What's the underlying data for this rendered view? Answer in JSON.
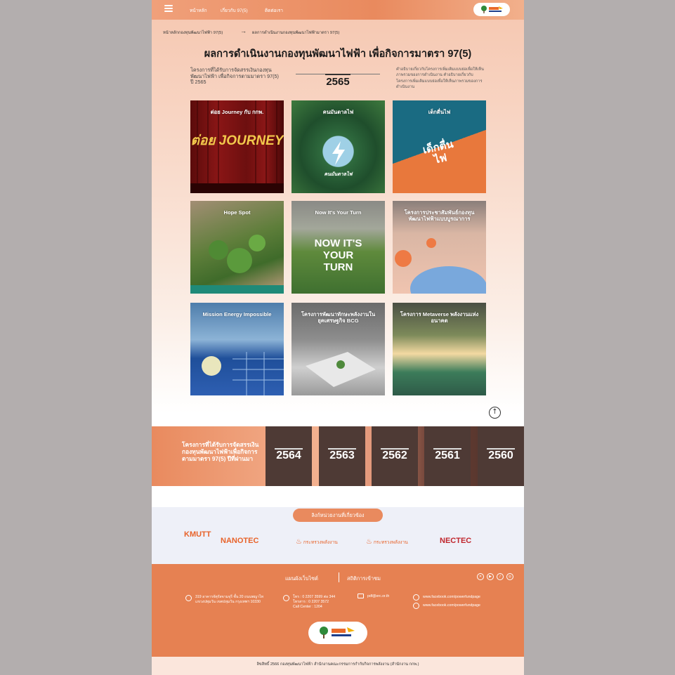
{
  "nav": {
    "links": [
      "หน้าหลัก",
      "เกี่ยวกับ 97(5)",
      "ติดต่อเรา"
    ]
  },
  "breadcrumb": {
    "home": "หน้าหลักกองทุนพัฒนาไฟฟ้า 97(5)",
    "current": "ผลการดำเนินงานกองทุนพัฒนาไฟฟ้ามาตรา 97(5)"
  },
  "title": "ผลการดำเนินงานกองทุนพัฒนาไฟฟ้า เพื่อกิจการมาตรา 97(5)",
  "intro": {
    "left": "โครงการที่ได้รับการจัดสรรเงินกองทุนพัฒนาไฟฟ้า เพื่อกิจการตามมาตรา 97(5) ปี 2565",
    "year": "2565",
    "right": "คำอธิบายเกี่ยวกับโครงการเพิ่มเติมแบบย่อเพื่อให้เห็นภาพรวมของการดำเนินงาน คำอธิบายเกี่ยวกับโครงการเพิ่มเติมแบบย่อเพื่อให้เห็นภาพรวมของการดำเนินงาน"
  },
  "projects": [
    {
      "title": "ต่อย Journey กับ กกพ.",
      "art": "ต่อย JOURNEY"
    },
    {
      "title": "คนมันตาลไฟ",
      "art": "คนมันตาลไฟ"
    },
    {
      "title": "เด็กตื่นไฟ",
      "art": "เด็กตื่นไฟ"
    },
    {
      "title": "Hope Spot",
      "art": ""
    },
    {
      "title": "Now It's Your Turn",
      "art": "NOW IT'S YOUR TURN"
    },
    {
      "title": "โครงการประชาสัมพันธ์กองทุนพัฒนาไฟฟ้าแบบบูรณาการ",
      "art": ""
    },
    {
      "title": "Mission Energy Impossible",
      "art": ""
    },
    {
      "title": "โครงการพัฒนาทักษะพลังงานในยุคเศรษฐกิจ BCG",
      "art": ""
    },
    {
      "title": "โครงการ Metaverse พลังงานแห่งอนาคต",
      "art": ""
    }
  ],
  "past": {
    "label": "โครงการที่ได้รับการจัดสรรเงินกองทุนพัฒนาไฟฟ้าเพื่อกิจการตามมาตรา 97(5) ปีที่ผ่านมา",
    "years": [
      "2564",
      "2563",
      "2562",
      "2561",
      "2560"
    ]
  },
  "agencies": {
    "button": "ลิงก์หน่วยงานที่เกี่ยวข้อง",
    "items": [
      "KMUTT",
      "NANOTEC",
      "กระทรวงพลังงาน",
      "กระทรวงพลังงาน",
      "NECTEC"
    ]
  },
  "footer": {
    "sitemap": "แผนผังเว็บไซต์",
    "stats": "สถิติการเข้าชม",
    "address": "319 อาคารจัตุรัสจามจุรี ชั้น 20 ถนนพญาไท แขวงปทุมวัน เขตปทุมวัน กรุงเทพฯ 10330",
    "phone": "โทร : 0 2207 3599 ต่อ 344",
    "fax": "โทรสาร : 0 2207 3572",
    "callcenter": "Call Center : 1204",
    "email": "pdf@erc.or.th",
    "fb1": "www.facebook.com/powerfundpage",
    "fb2": "www.facebook.com/powerfundpage"
  },
  "copyright": "ลิขสิทธิ์ 2566 กองทุนพัฒนาไฟฟ้า สำนักงานคณะกรรมการกำกับกิจการพลังงาน (สำนักงาน กกพ.)"
}
